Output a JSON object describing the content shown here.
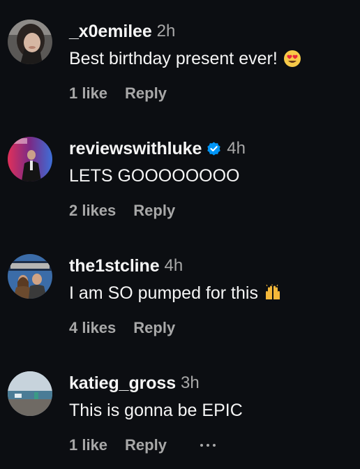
{
  "comments": [
    {
      "username": "_x0emilee",
      "time": "2h",
      "text": "Best birthday present ever!",
      "text_emoji": "heart-eyes-emoji",
      "likes": "1 like",
      "reply": "Reply",
      "verified": false
    },
    {
      "username": "reviewswithluke",
      "time": "4h",
      "text": "LETS GOOOOOOOO",
      "likes": "2 likes",
      "reply": "Reply",
      "verified": true
    },
    {
      "username": "the1stcline",
      "time": "4h",
      "text": "I am SO pumped for this",
      "text_emoji": "raising-hands-emoji",
      "likes": "4 likes",
      "reply": "Reply",
      "verified": false
    },
    {
      "username": "katieg_gross",
      "time": "3h",
      "text": "This is gonna be EPIC",
      "likes": "1 like",
      "reply": "Reply",
      "verified": false,
      "more_icon": "more-options-icon"
    }
  ],
  "colors": {
    "background": "#0c0e12",
    "primary_text": "#f5f5f5",
    "secondary_text": "#a8a8a8",
    "verified_blue": "#0095f6"
  }
}
